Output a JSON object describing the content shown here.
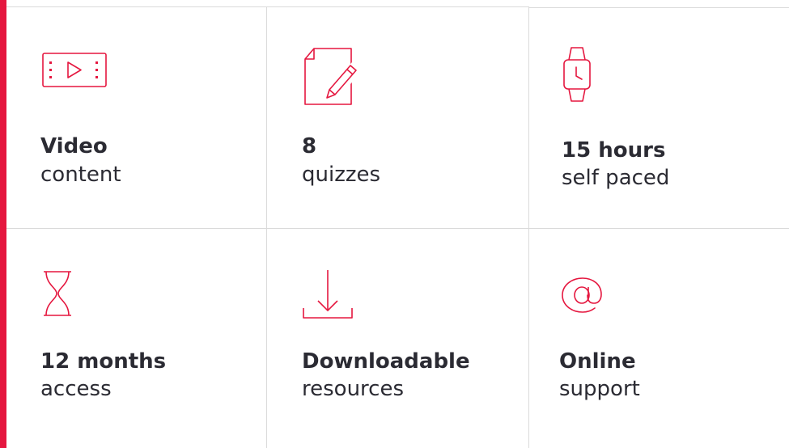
{
  "accent_color": "#e5173f",
  "features": [
    {
      "icon": "video-icon",
      "title": "Video",
      "subtitle": "content"
    },
    {
      "icon": "quiz-edit-icon",
      "title": "8",
      "subtitle": "quizzes"
    },
    {
      "icon": "smartwatch-icon",
      "title": "15 hours",
      "subtitle": "self paced"
    },
    {
      "icon": "hourglass-icon",
      "title": "12 months",
      "subtitle": "access"
    },
    {
      "icon": "download-icon",
      "title": "Downloadable",
      "subtitle": "resources"
    },
    {
      "icon": "at-sign-icon",
      "title": "Online",
      "subtitle": "support"
    }
  ]
}
